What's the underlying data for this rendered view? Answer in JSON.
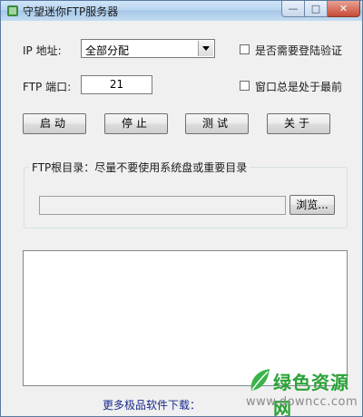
{
  "window": {
    "title": "守望迷你FTP服务器"
  },
  "title_controls": {
    "minimize": "—",
    "maximize": "□",
    "close": "✕"
  },
  "ip": {
    "label": "IP 地址:",
    "selected": "全部分配"
  },
  "port": {
    "label": "FTP 端口:",
    "value": "21"
  },
  "options": {
    "require_login": "是否需要登陆验证",
    "always_on_top": "窗口总是处于最前"
  },
  "buttons": {
    "start": "启动",
    "stop": "停止",
    "test": "测试",
    "about": "关于"
  },
  "root_dir": {
    "group_title": "FTP根目录：尽量不要使用系统盘或重要目录",
    "path": "",
    "browse": "浏览..."
  },
  "footer": {
    "more_software": "更多极品软件下载："
  },
  "watermark": {
    "site_name": "绿色资源网",
    "url": "www.downcc.com"
  },
  "colors": {
    "watermark_green": "#2aa236",
    "link_blue": "#1a2a8c"
  }
}
